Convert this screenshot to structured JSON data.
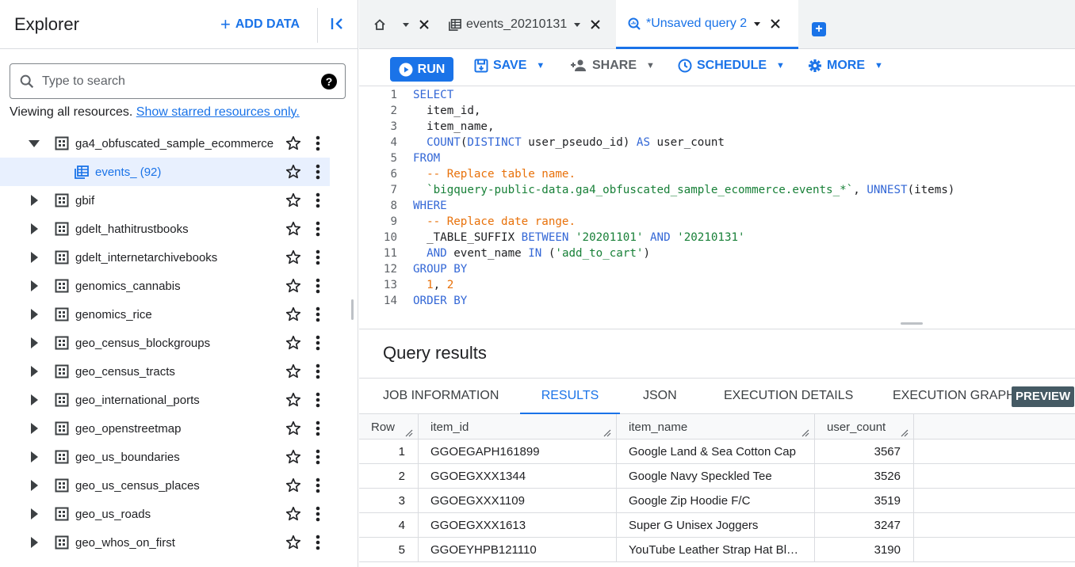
{
  "explorer": {
    "title": "Explorer",
    "add_data_label": "ADD DATA",
    "search_placeholder": "Type to search",
    "viewing_text": "Viewing all resources.",
    "starred_link": "Show starred resources only.",
    "expanded_dataset": "ga4_obfuscated_sample_ecommerce",
    "child_table": "events_ (92)",
    "datasets": [
      "gbif",
      "gdelt_hathitrustbooks",
      "gdelt_internetarchivebooks",
      "genomics_cannabis",
      "genomics_rice",
      "geo_census_blockgroups",
      "geo_census_tracts",
      "geo_international_ports",
      "geo_openstreetmap",
      "geo_us_boundaries",
      "geo_us_census_places",
      "geo_us_roads",
      "geo_whos_on_first"
    ]
  },
  "tabs": [
    {
      "label": ""
    },
    {
      "label": "events_20210131"
    },
    {
      "label": "*Unsaved query 2"
    }
  ],
  "toolbar": {
    "run": "RUN",
    "save": "SAVE",
    "share": "SHARE",
    "schedule": "SCHEDULE",
    "more": "MORE"
  },
  "editor": {
    "lines": [
      [
        {
          "t": "SELECT",
          "c": "kw"
        }
      ],
      [
        {
          "t": "  item_id,",
          "c": "tx"
        }
      ],
      [
        {
          "t": "  item_name,",
          "c": "tx"
        }
      ],
      [
        {
          "t": "  ",
          "c": "tx"
        },
        {
          "t": "COUNT",
          "c": "fn"
        },
        {
          "t": "(",
          "c": "tx"
        },
        {
          "t": "DISTINCT",
          "c": "kw"
        },
        {
          "t": " user_pseudo_id) ",
          "c": "tx"
        },
        {
          "t": "AS",
          "c": "kw"
        },
        {
          "t": " user_count",
          "c": "tx"
        }
      ],
      [
        {
          "t": "FROM",
          "c": "kw"
        }
      ],
      [
        {
          "t": "  -- Replace table name.",
          "c": "cm"
        }
      ],
      [
        {
          "t": "  `bigquery-public-data.ga4_obfuscated_sample_ecommerce.events_*`",
          "c": "st"
        },
        {
          "t": ", ",
          "c": "tx"
        },
        {
          "t": "UNNEST",
          "c": "fn"
        },
        {
          "t": "(items)",
          "c": "tx"
        }
      ],
      [
        {
          "t": "WHERE",
          "c": "kw"
        }
      ],
      [
        {
          "t": "  -- Replace date range.",
          "c": "cm"
        }
      ],
      [
        {
          "t": "  _TABLE_SUFFIX ",
          "c": "tx"
        },
        {
          "t": "BETWEEN",
          "c": "kw"
        },
        {
          "t": " ",
          "c": "tx"
        },
        {
          "t": "'20201101'",
          "c": "st"
        },
        {
          "t": " ",
          "c": "tx"
        },
        {
          "t": "AND",
          "c": "kw"
        },
        {
          "t": " ",
          "c": "tx"
        },
        {
          "t": "'20210131'",
          "c": "st"
        }
      ],
      [
        {
          "t": "  ",
          "c": "tx"
        },
        {
          "t": "AND",
          "c": "kw"
        },
        {
          "t": " event_name ",
          "c": "tx"
        },
        {
          "t": "IN",
          "c": "kw"
        },
        {
          "t": " (",
          "c": "tx"
        },
        {
          "t": "'add_to_cart'",
          "c": "st"
        },
        {
          "t": ")",
          "c": "tx"
        }
      ],
      [
        {
          "t": "GROUP BY",
          "c": "kw"
        }
      ],
      [
        {
          "t": "  ",
          "c": "tx"
        },
        {
          "t": "1",
          "c": "nm"
        },
        {
          "t": ", ",
          "c": "tx"
        },
        {
          "t": "2",
          "c": "nm"
        }
      ],
      [
        {
          "t": "ORDER BY",
          "c": "kw"
        }
      ]
    ]
  },
  "results": {
    "title": "Query results",
    "tabs": [
      "JOB INFORMATION",
      "RESULTS",
      "JSON",
      "EXECUTION DETAILS",
      "EXECUTION GRAPH"
    ],
    "preview_badge": "PREVIEW",
    "columns": [
      "Row",
      "item_id",
      "item_name",
      "user_count"
    ],
    "rows": [
      [
        "1",
        "GGOEGAPH161899",
        "Google Land & Sea Cotton Cap",
        "3567"
      ],
      [
        "2",
        "GGOEGXXX1344",
        "Google Navy Speckled Tee",
        "3526"
      ],
      [
        "3",
        "GGOEGXXX1109",
        "Google Zip Hoodie F/C",
        "3519"
      ],
      [
        "4",
        "GGOEGXXX1613",
        "Super G Unisex Joggers",
        "3247"
      ],
      [
        "5",
        "GGOEYHPB121110",
        "YouTube Leather Strap Hat Black",
        "3190"
      ]
    ]
  },
  "colors": {
    "accent": "#1a73e8",
    "selected_bg": "#e8f0fe",
    "preview_badge": "#455a64"
  }
}
